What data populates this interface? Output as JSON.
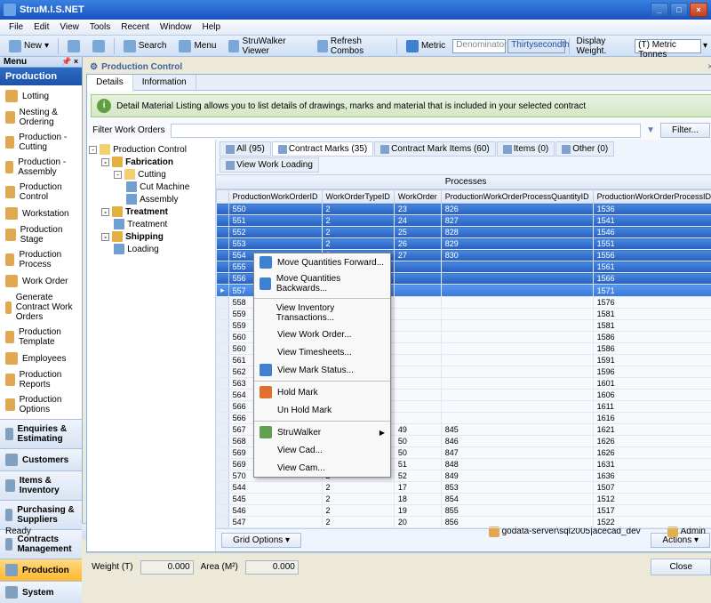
{
  "window": {
    "title": "StruM.I.S.NET"
  },
  "menubar": [
    "File",
    "Edit",
    "View",
    "Tools",
    "Recent",
    "Window",
    "Help"
  ],
  "toolbar": {
    "new": "New",
    "search": "Search",
    "menu": "Menu",
    "struwalker": "StruWalker Viewer",
    "refresh": "Refresh Combos",
    "metric": "Metric",
    "denom": "Denominator",
    "thirty": "Thirtysecondth",
    "display_weight": "Display Weight.",
    "tonnes": "(T) Metric Tonnes"
  },
  "left": {
    "menu_hdr": "Menu",
    "section": "Production",
    "items": [
      "Lotting",
      "Nesting & Ordering",
      "Production - Cutting",
      "Production - Assembly",
      "Production Control",
      "Workstation",
      "Production Stage",
      "Production Process",
      "Work Order",
      "Generate Contract Work Orders",
      "Production Template",
      "Employees",
      "Production Reports",
      "Production Options"
    ],
    "bottom": [
      "Enquiries & Estimating",
      "Customers",
      "Items & Inventory",
      "Purchasing & Suppliers",
      "Contracts Management",
      "Production",
      "System"
    ]
  },
  "content": {
    "title": "Production Control",
    "tabs": [
      "Details",
      "Information"
    ],
    "info": "Detail Material Listing allows you to list details of drawings, marks and material that is included in your selected contract",
    "filter_label": "Filter Work Orders",
    "filter_btn": "Filter...",
    "tree": [
      {
        "d": 0,
        "t": "-",
        "label": "Production Control",
        "icn": "#f0d070"
      },
      {
        "d": 1,
        "t": "-",
        "label": "Fabrication",
        "icn": "#e0b040",
        "bold": true
      },
      {
        "d": 2,
        "t": "-",
        "label": "Cutting",
        "icn": "#f0d070"
      },
      {
        "d": 3,
        "t": "",
        "label": "Cut Machine",
        "icn": "#70a0d0"
      },
      {
        "d": 3,
        "t": "",
        "label": "Assembly",
        "icn": "#70a0d0"
      },
      {
        "d": 1,
        "t": "-",
        "label": "Treatment",
        "icn": "#e0b040",
        "bold": true
      },
      {
        "d": 2,
        "t": "",
        "label": "Treatment",
        "icn": "#70a0d0"
      },
      {
        "d": 1,
        "t": "-",
        "label": "Shipping",
        "icn": "#e0b040",
        "bold": true
      },
      {
        "d": 2,
        "t": "",
        "label": "Loading",
        "icn": "#70a0d0"
      }
    ],
    "grid_tabs": [
      {
        "label": "All (95)"
      },
      {
        "label": "Contract Marks (35)",
        "active": true
      },
      {
        "label": "Contract Mark Items (60)"
      },
      {
        "label": "Items (0)"
      },
      {
        "label": "Other (0)"
      },
      {
        "label": "View Work Loading"
      }
    ],
    "processes": "Processes",
    "columns": [
      "ProductionWorkOrderID",
      "WorkOrderTypeID",
      "WorkOrder",
      "ProductionWorkOrderProcessQuantityID",
      "ProductionWorkOrderProcessID"
    ],
    "rows": [
      {
        "sel": true,
        "c": [
          "550",
          "2",
          "23",
          "826",
          "1536"
        ]
      },
      {
        "sel": true,
        "c": [
          "551",
          "2",
          "24",
          "827",
          "1541"
        ]
      },
      {
        "sel": true,
        "c": [
          "552",
          "2",
          "25",
          "828",
          "1546"
        ]
      },
      {
        "sel": true,
        "c": [
          "553",
          "2",
          "26",
          "829",
          "1551"
        ]
      },
      {
        "sel": true,
        "c": [
          "554",
          "2",
          "27",
          "830",
          "1556"
        ]
      },
      {
        "sel": true,
        "c": [
          "555",
          "2",
          "",
          "",
          "1561"
        ]
      },
      {
        "sel": true,
        "c": [
          "556",
          "2",
          "",
          "",
          "1566"
        ]
      },
      {
        "sel": true,
        "mark": true,
        "c": [
          "557",
          "2",
          "",
          "",
          "1571"
        ]
      },
      {
        "c": [
          "558",
          "2",
          "",
          "",
          "1576"
        ]
      },
      {
        "c": [
          "559",
          "2",
          "",
          "",
          "1581"
        ]
      },
      {
        "c": [
          "559",
          "2",
          "",
          "",
          "1581"
        ]
      },
      {
        "c": [
          "560",
          "2",
          "",
          "",
          "1586"
        ]
      },
      {
        "c": [
          "560",
          "2",
          "",
          "",
          "1586"
        ]
      },
      {
        "c": [
          "561",
          "2",
          "",
          "",
          "1591"
        ]
      },
      {
        "c": [
          "562",
          "2",
          "",
          "",
          "1596"
        ]
      },
      {
        "c": [
          "563",
          "2",
          "",
          "",
          "1601"
        ]
      },
      {
        "c": [
          "564",
          "2",
          "",
          "",
          "1606"
        ]
      },
      {
        "c": [
          "566",
          "2",
          "",
          "",
          "1611"
        ]
      },
      {
        "c": [
          "566",
          "2",
          "",
          "",
          "1616"
        ]
      },
      {
        "c": [
          "567",
          "2",
          "49",
          "845",
          "1621"
        ]
      },
      {
        "c": [
          "568",
          "2",
          "50",
          "846",
          "1626"
        ]
      },
      {
        "c": [
          "569",
          "2",
          "50",
          "847",
          "1626"
        ]
      },
      {
        "c": [
          "569",
          "2",
          "51",
          "848",
          "1631"
        ]
      },
      {
        "c": [
          "570",
          "2",
          "52",
          "849",
          "1636"
        ]
      },
      {
        "c": [
          "544",
          "2",
          "17",
          "853",
          "1507"
        ]
      },
      {
        "c": [
          "545",
          "2",
          "18",
          "854",
          "1512"
        ]
      },
      {
        "c": [
          "546",
          "2",
          "19",
          "855",
          "1517"
        ]
      },
      {
        "c": [
          "547",
          "2",
          "20",
          "856",
          "1522"
        ]
      }
    ],
    "grid_options": "Grid Options",
    "actions": "Actions",
    "weight_label": "Weight (T)",
    "weight_val": "0.000",
    "area_label": "Area (M²)",
    "area_val": "0.000",
    "close": "Close"
  },
  "context_menu": [
    {
      "label": "Move Quantities Forward...",
      "icn": "#4080d0"
    },
    {
      "label": "Move Quantities Backwards...",
      "icn": "#4080d0"
    },
    {
      "sep": true
    },
    {
      "label": "View Inventory Transactions..."
    },
    {
      "label": "View Work Order..."
    },
    {
      "label": "View Timesheets..."
    },
    {
      "label": "View Mark Status...",
      "icn": "#4080d0"
    },
    {
      "sep": true
    },
    {
      "label": "Hold Mark",
      "icn": "#e07030"
    },
    {
      "label": "Un Hold Mark"
    },
    {
      "sep": true
    },
    {
      "label": "StruWalker",
      "icn": "#60a050",
      "sub": true
    },
    {
      "label": "View Cad..."
    },
    {
      "label": "View Cam..."
    }
  ],
  "status": {
    "ready": "Ready",
    "server": "godata-server\\sql2005|acecad_dev",
    "admin": "Admin"
  }
}
